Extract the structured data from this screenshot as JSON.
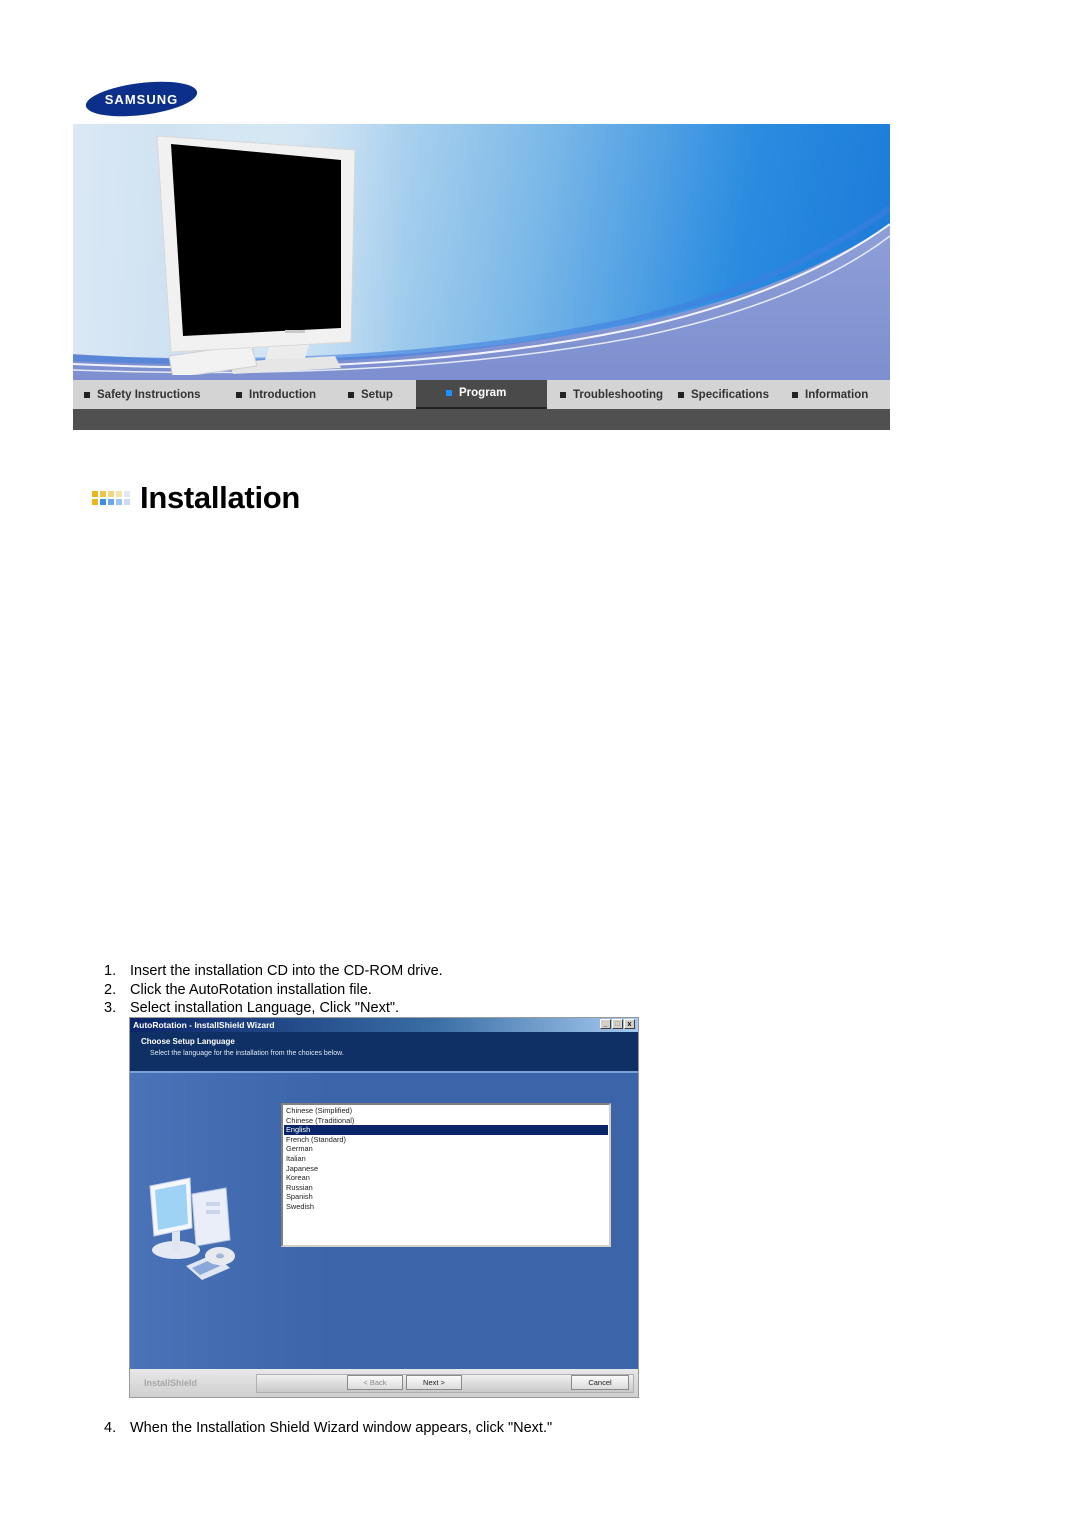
{
  "brand": {
    "logo_text": "SAMSUNG",
    "logo_color": "#0b2f8a"
  },
  "nav": {
    "items": [
      {
        "label": "Safety Instructions",
        "active": false
      },
      {
        "label": "Introduction",
        "active": false
      },
      {
        "label": "Setup",
        "active": false
      },
      {
        "label": "Program",
        "active": true
      },
      {
        "label": "Troubleshooting",
        "active": false
      },
      {
        "label": "Specifications",
        "active": false
      },
      {
        "label": "Information",
        "active": false
      }
    ],
    "active_color": "#1e90ff"
  },
  "page": {
    "title": "Installation",
    "steps": [
      {
        "num": "1.",
        "text": "Insert the installation CD into the CD-ROM drive."
      },
      {
        "num": "2.",
        "text": "Click the AutoRotation installation file."
      },
      {
        "num": "3.",
        "text": "Select installation Language, Click \"Next\"."
      },
      {
        "num": "4.",
        "text": "When the Installation Shield Wizard window appears, click \"Next.\""
      }
    ]
  },
  "wizard": {
    "title": "AutoRotation - InstallShield Wizard",
    "controls": {
      "minimize": "_",
      "maximize": "□",
      "close": "x"
    },
    "header_title": "Choose Setup Language",
    "header_subtitle": "Select the language for the installation from the choices below.",
    "languages": [
      "Chinese (Simplified)",
      "Chinese (Traditional)",
      "English",
      "French (Standard)",
      "German",
      "Italian",
      "Japanese",
      "Korean",
      "Russian",
      "Spanish",
      "Swedish"
    ],
    "selected_language": "English",
    "brand": "InstallShield",
    "buttons": {
      "back": "< Back",
      "next": "Next >",
      "cancel": "Cancel"
    }
  }
}
